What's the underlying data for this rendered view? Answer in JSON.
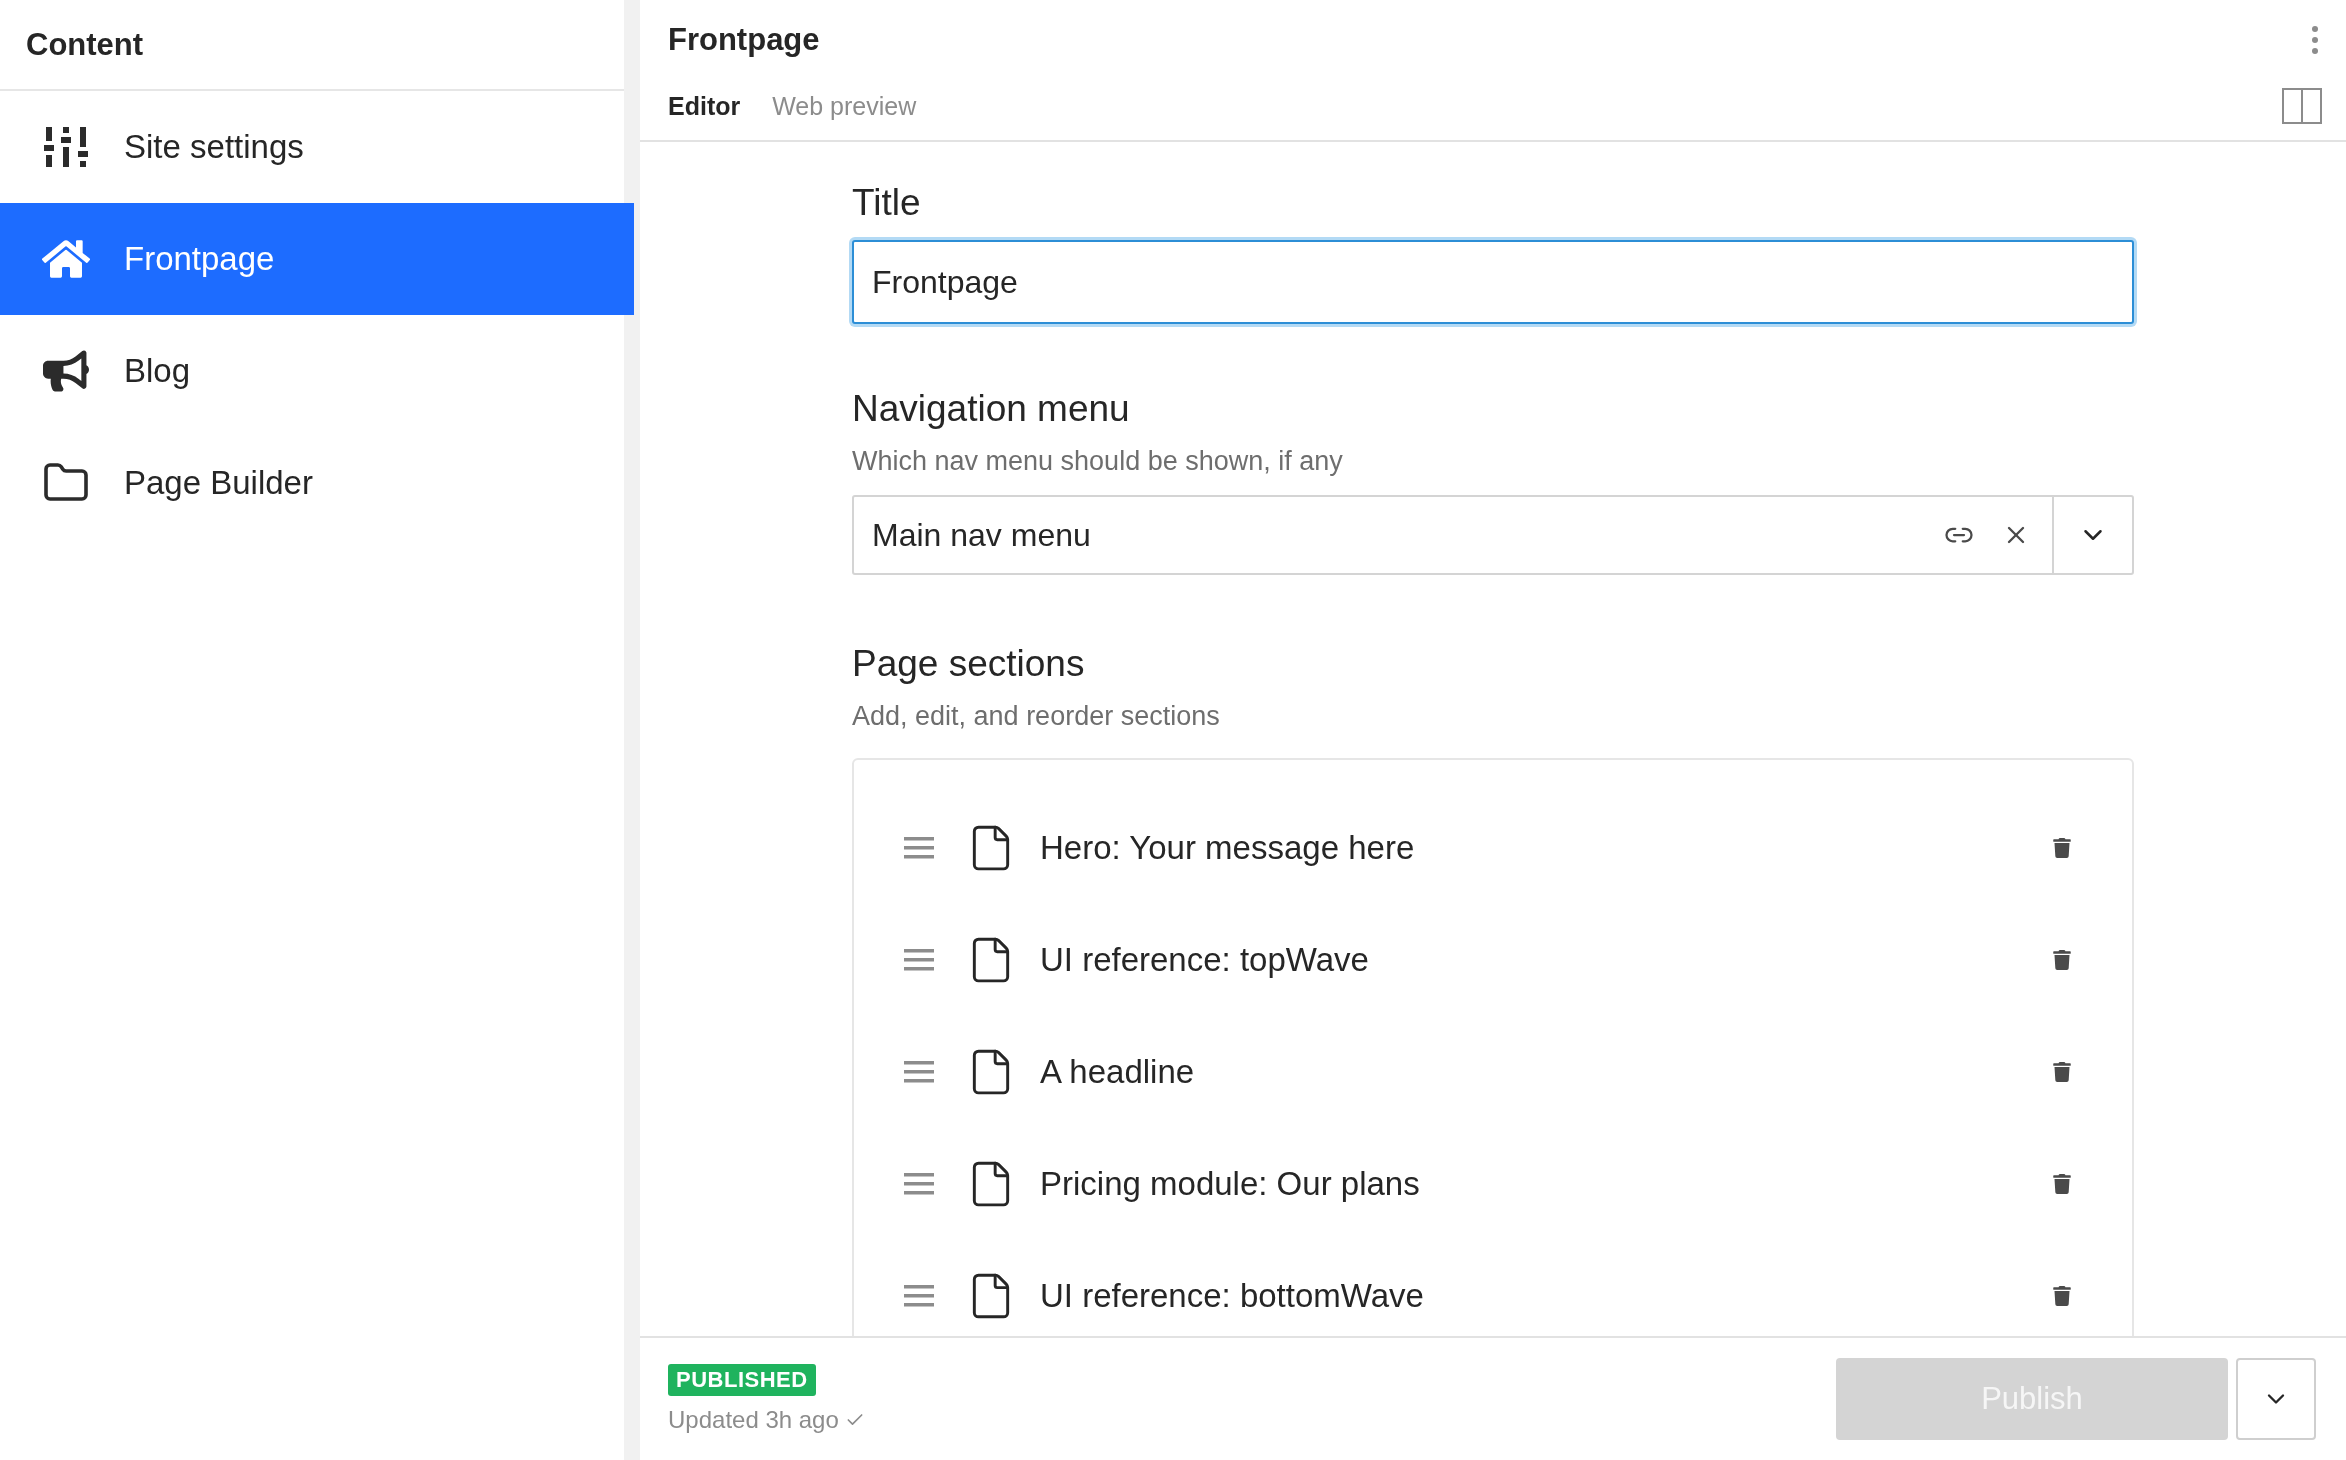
{
  "sidebar": {
    "title": "Content",
    "items": [
      {
        "label": "Site settings",
        "kind": "settings",
        "selected": false
      },
      {
        "label": "Frontpage",
        "kind": "home",
        "selected": true
      },
      {
        "label": "Blog",
        "kind": "blog",
        "selected": false
      },
      {
        "label": "Page Builder",
        "kind": "builder",
        "selected": false
      }
    ]
  },
  "document": {
    "title": "Frontpage",
    "tabs": [
      {
        "label": "Editor",
        "selected": true
      },
      {
        "label": "Web preview",
        "selected": false
      }
    ]
  },
  "title_field": {
    "label": "Title",
    "value": "Frontpage",
    "focused": true
  },
  "navigation_menu": {
    "label": "Navigation menu",
    "description": "Which nav menu should be shown, if any",
    "value": "Main nav menu"
  },
  "page_sections": {
    "label": "Page sections",
    "description": "Add, edit, and reorder sections",
    "items": [
      {
        "label": "Hero: Your message here"
      },
      {
        "label": "UI reference: topWave"
      },
      {
        "label": "A headline"
      },
      {
        "label": "Pricing module: Our plans"
      },
      {
        "label": "UI reference: bottomWave"
      }
    ]
  },
  "footer": {
    "status": "PUBLISHED",
    "updated": "Updated 3h ago",
    "publish_button": {
      "label": "Publish",
      "disabled": true
    }
  }
}
